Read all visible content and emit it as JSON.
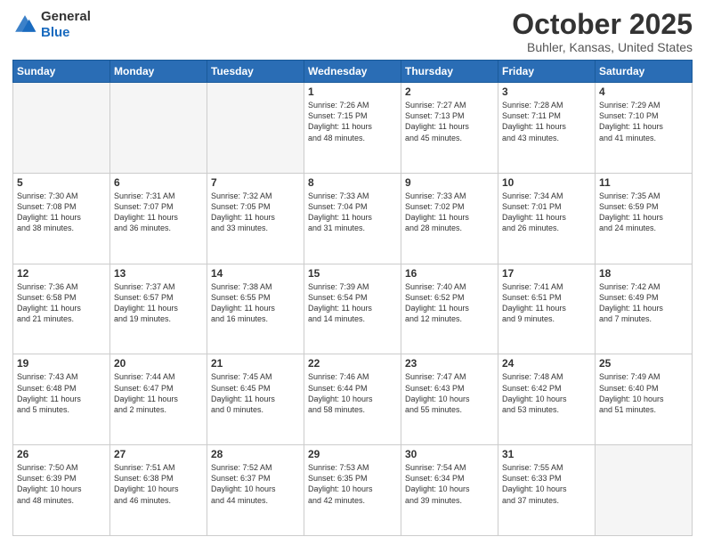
{
  "header": {
    "logo_general": "General",
    "logo_blue": "Blue",
    "month_title": "October 2025",
    "location": "Buhler, Kansas, United States"
  },
  "days_of_week": [
    "Sunday",
    "Monday",
    "Tuesday",
    "Wednesday",
    "Thursday",
    "Friday",
    "Saturday"
  ],
  "weeks": [
    [
      {
        "day": "",
        "info": ""
      },
      {
        "day": "",
        "info": ""
      },
      {
        "day": "",
        "info": ""
      },
      {
        "day": "1",
        "info": "Sunrise: 7:26 AM\nSunset: 7:15 PM\nDaylight: 11 hours\nand 48 minutes."
      },
      {
        "day": "2",
        "info": "Sunrise: 7:27 AM\nSunset: 7:13 PM\nDaylight: 11 hours\nand 45 minutes."
      },
      {
        "day": "3",
        "info": "Sunrise: 7:28 AM\nSunset: 7:11 PM\nDaylight: 11 hours\nand 43 minutes."
      },
      {
        "day": "4",
        "info": "Sunrise: 7:29 AM\nSunset: 7:10 PM\nDaylight: 11 hours\nand 41 minutes."
      }
    ],
    [
      {
        "day": "5",
        "info": "Sunrise: 7:30 AM\nSunset: 7:08 PM\nDaylight: 11 hours\nand 38 minutes."
      },
      {
        "day": "6",
        "info": "Sunrise: 7:31 AM\nSunset: 7:07 PM\nDaylight: 11 hours\nand 36 minutes."
      },
      {
        "day": "7",
        "info": "Sunrise: 7:32 AM\nSunset: 7:05 PM\nDaylight: 11 hours\nand 33 minutes."
      },
      {
        "day": "8",
        "info": "Sunrise: 7:33 AM\nSunset: 7:04 PM\nDaylight: 11 hours\nand 31 minutes."
      },
      {
        "day": "9",
        "info": "Sunrise: 7:33 AM\nSunset: 7:02 PM\nDaylight: 11 hours\nand 28 minutes."
      },
      {
        "day": "10",
        "info": "Sunrise: 7:34 AM\nSunset: 7:01 PM\nDaylight: 11 hours\nand 26 minutes."
      },
      {
        "day": "11",
        "info": "Sunrise: 7:35 AM\nSunset: 6:59 PM\nDaylight: 11 hours\nand 24 minutes."
      }
    ],
    [
      {
        "day": "12",
        "info": "Sunrise: 7:36 AM\nSunset: 6:58 PM\nDaylight: 11 hours\nand 21 minutes."
      },
      {
        "day": "13",
        "info": "Sunrise: 7:37 AM\nSunset: 6:57 PM\nDaylight: 11 hours\nand 19 minutes."
      },
      {
        "day": "14",
        "info": "Sunrise: 7:38 AM\nSunset: 6:55 PM\nDaylight: 11 hours\nand 16 minutes."
      },
      {
        "day": "15",
        "info": "Sunrise: 7:39 AM\nSunset: 6:54 PM\nDaylight: 11 hours\nand 14 minutes."
      },
      {
        "day": "16",
        "info": "Sunrise: 7:40 AM\nSunset: 6:52 PM\nDaylight: 11 hours\nand 12 minutes."
      },
      {
        "day": "17",
        "info": "Sunrise: 7:41 AM\nSunset: 6:51 PM\nDaylight: 11 hours\nand 9 minutes."
      },
      {
        "day": "18",
        "info": "Sunrise: 7:42 AM\nSunset: 6:49 PM\nDaylight: 11 hours\nand 7 minutes."
      }
    ],
    [
      {
        "day": "19",
        "info": "Sunrise: 7:43 AM\nSunset: 6:48 PM\nDaylight: 11 hours\nand 5 minutes."
      },
      {
        "day": "20",
        "info": "Sunrise: 7:44 AM\nSunset: 6:47 PM\nDaylight: 11 hours\nand 2 minutes."
      },
      {
        "day": "21",
        "info": "Sunrise: 7:45 AM\nSunset: 6:45 PM\nDaylight: 11 hours\nand 0 minutes."
      },
      {
        "day": "22",
        "info": "Sunrise: 7:46 AM\nSunset: 6:44 PM\nDaylight: 10 hours\nand 58 minutes."
      },
      {
        "day": "23",
        "info": "Sunrise: 7:47 AM\nSunset: 6:43 PM\nDaylight: 10 hours\nand 55 minutes."
      },
      {
        "day": "24",
        "info": "Sunrise: 7:48 AM\nSunset: 6:42 PM\nDaylight: 10 hours\nand 53 minutes."
      },
      {
        "day": "25",
        "info": "Sunrise: 7:49 AM\nSunset: 6:40 PM\nDaylight: 10 hours\nand 51 minutes."
      }
    ],
    [
      {
        "day": "26",
        "info": "Sunrise: 7:50 AM\nSunset: 6:39 PM\nDaylight: 10 hours\nand 48 minutes."
      },
      {
        "day": "27",
        "info": "Sunrise: 7:51 AM\nSunset: 6:38 PM\nDaylight: 10 hours\nand 46 minutes."
      },
      {
        "day": "28",
        "info": "Sunrise: 7:52 AM\nSunset: 6:37 PM\nDaylight: 10 hours\nand 44 minutes."
      },
      {
        "day": "29",
        "info": "Sunrise: 7:53 AM\nSunset: 6:35 PM\nDaylight: 10 hours\nand 42 minutes."
      },
      {
        "day": "30",
        "info": "Sunrise: 7:54 AM\nSunset: 6:34 PM\nDaylight: 10 hours\nand 39 minutes."
      },
      {
        "day": "31",
        "info": "Sunrise: 7:55 AM\nSunset: 6:33 PM\nDaylight: 10 hours\nand 37 minutes."
      },
      {
        "day": "",
        "info": ""
      }
    ]
  ]
}
